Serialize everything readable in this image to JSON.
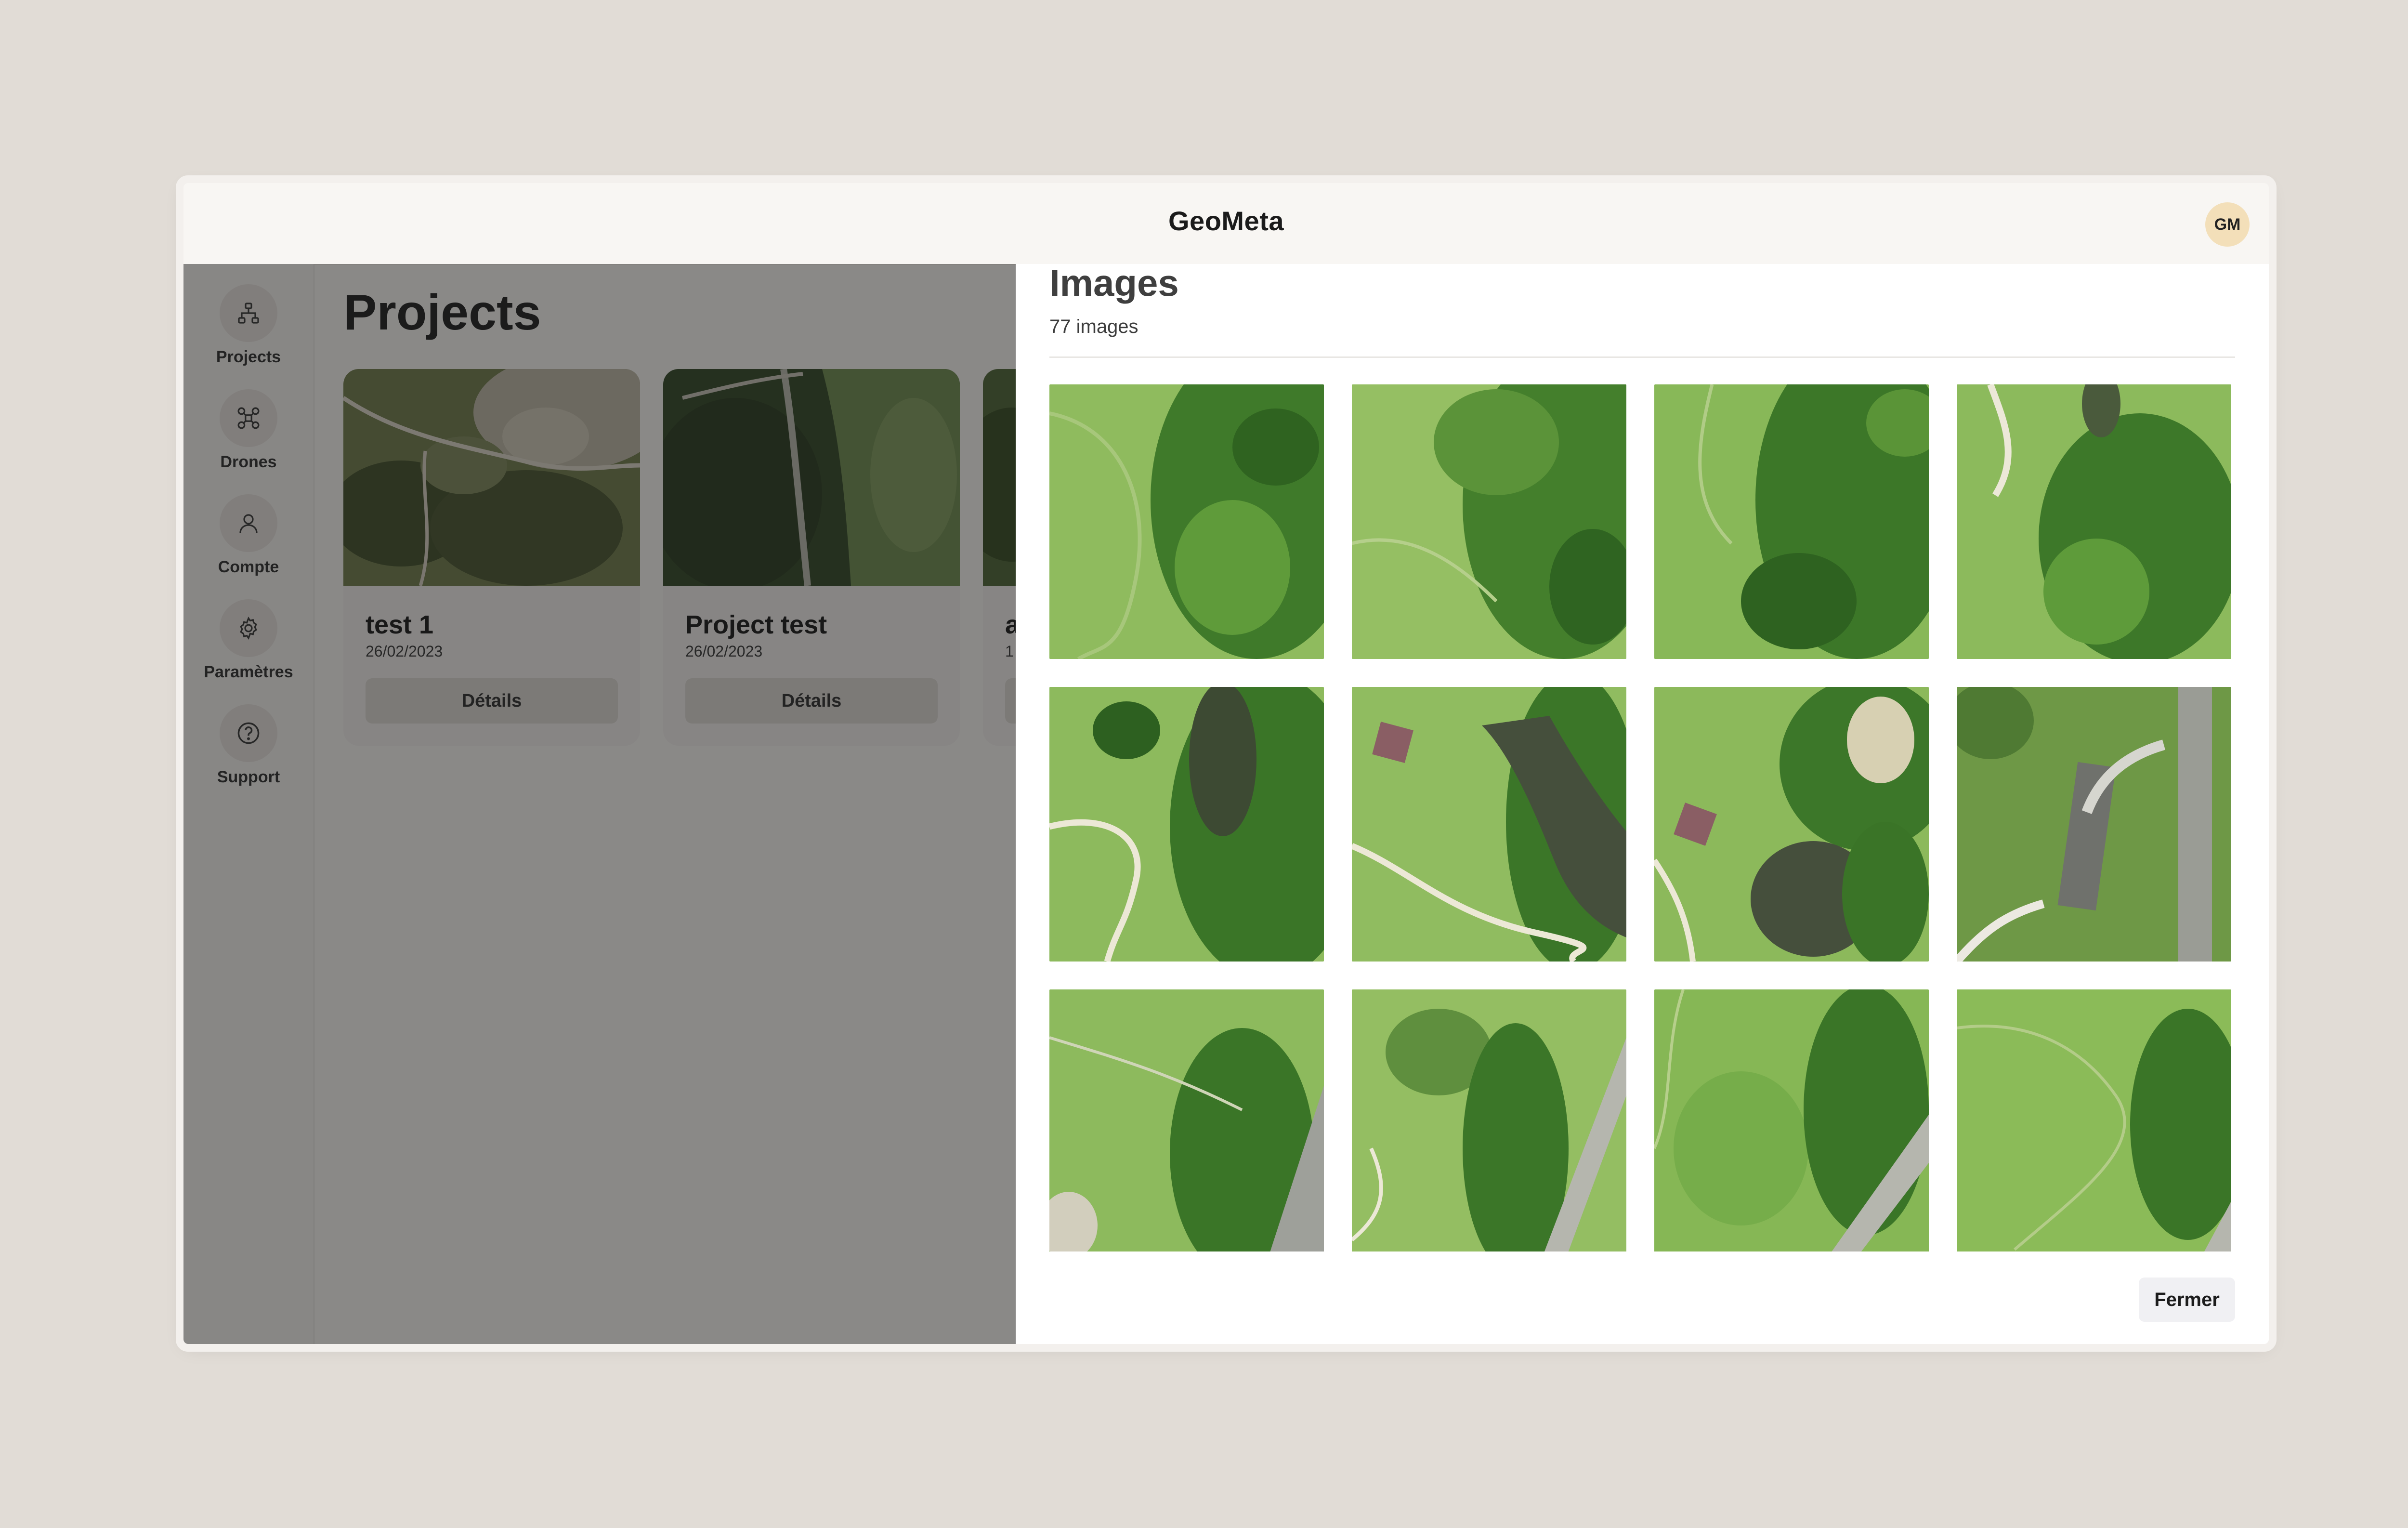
{
  "app": {
    "title": "GeoMeta",
    "avatar_initials": "GM"
  },
  "sidebar": {
    "items": [
      {
        "label": "Projects",
        "icon": "hierarchy-icon"
      },
      {
        "label": "Drones",
        "icon": "drone-icon"
      },
      {
        "label": "Compte",
        "icon": "user-icon"
      },
      {
        "label": "Paramètres",
        "icon": "gear-icon"
      },
      {
        "label": "Support",
        "icon": "help-circle-icon"
      }
    ]
  },
  "page": {
    "title": "Projects",
    "cards": [
      {
        "title": "test 1",
        "date": "26/02/2023",
        "button": "Détails"
      },
      {
        "title": "Project test",
        "date": "26/02/2023",
        "button": "Détails"
      },
      {
        "title": "a",
        "date": "1",
        "button": ""
      }
    ]
  },
  "modal": {
    "title": "Images",
    "count": "77 images",
    "close_label": "Fermer",
    "thumbnails": [
      "aerial-thumbnail",
      "aerial-thumbnail",
      "aerial-thumbnail",
      "aerial-thumbnail",
      "aerial-thumbnail",
      "aerial-thumbnail",
      "aerial-thumbnail",
      "aerial-thumbnail",
      "aerial-thumbnail",
      "aerial-thumbnail",
      "aerial-thumbnail",
      "aerial-thumbnail"
    ]
  },
  "colors": {
    "background": "#e1dcd6",
    "overlay": "#1c1c1c",
    "grass": "#86b55a",
    "trees": "#2f6a23",
    "avatar": "#f3dfb9"
  }
}
